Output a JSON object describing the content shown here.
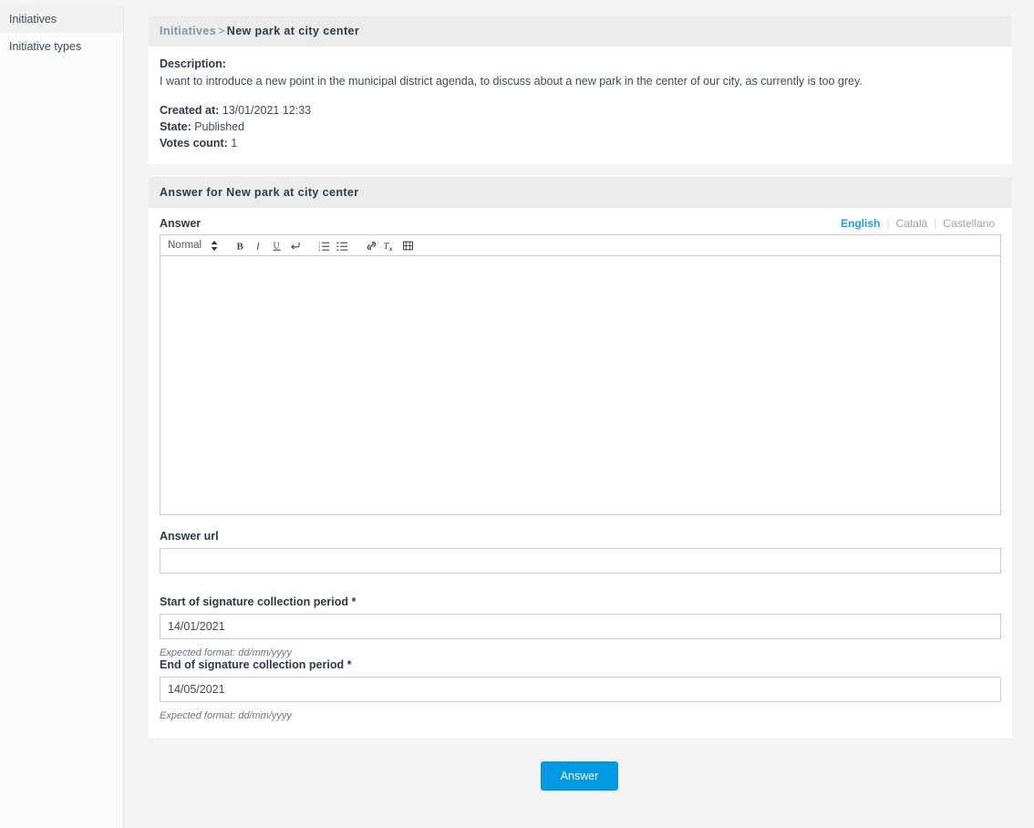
{
  "sidebar": {
    "items": [
      {
        "label": "Initiatives",
        "name": "sidebar-item-initiatives",
        "active": true
      },
      {
        "label": "Initiative types",
        "name": "sidebar-item-initiative-types",
        "active": false
      }
    ]
  },
  "breadcrumb": {
    "parent": "Initiatives",
    "separator": ">",
    "current": "New park at city center"
  },
  "detail": {
    "description_label": "Description:",
    "description_text": "I want to introduce a new point in the municipal district agenda, to discuss about a new park in the center of our city, as currently is too grey.",
    "created_at_label": "Created at:",
    "created_at_value": "13/01/2021 12:33",
    "state_label": "State:",
    "state_value": "Published",
    "votes_label": "Votes count:",
    "votes_value": "1"
  },
  "answer_card": {
    "header": "Answer for New park at city center",
    "answer_field": {
      "label": "Answer",
      "value": "",
      "languages": [
        {
          "label": "English",
          "active": true
        },
        {
          "label": "Català",
          "active": false
        },
        {
          "label": "Castellano",
          "active": false
        }
      ],
      "toolbar": {
        "format_label": "Normal",
        "buttons": [
          "bold-icon",
          "italic-icon",
          "underline-icon",
          "line-break-icon",
          "ordered-list-icon",
          "bullet-list-icon",
          "link-icon",
          "clear-format-icon",
          "embed-video-icon"
        ]
      }
    },
    "answer_url_field": {
      "label": "Answer url",
      "value": "",
      "placeholder": ""
    },
    "start_date_field": {
      "label": "Start of signature collection period",
      "required_marker": "*",
      "value": "14/01/2021",
      "hint": "Expected format: dd/mm/yyyy"
    },
    "end_date_field": {
      "label": "End of signature collection period",
      "required_marker": "*",
      "value": "14/05/2021",
      "hint": "Expected format: dd/mm/yyyy"
    }
  },
  "submit": {
    "label": "Answer"
  },
  "colors": {
    "accent_blue": "#0099e5",
    "tab_active": "#16a2e7",
    "crumb_link": "#7d97ad",
    "card_header_bg": "#ececec",
    "page_bg": "#f4f4f4"
  }
}
